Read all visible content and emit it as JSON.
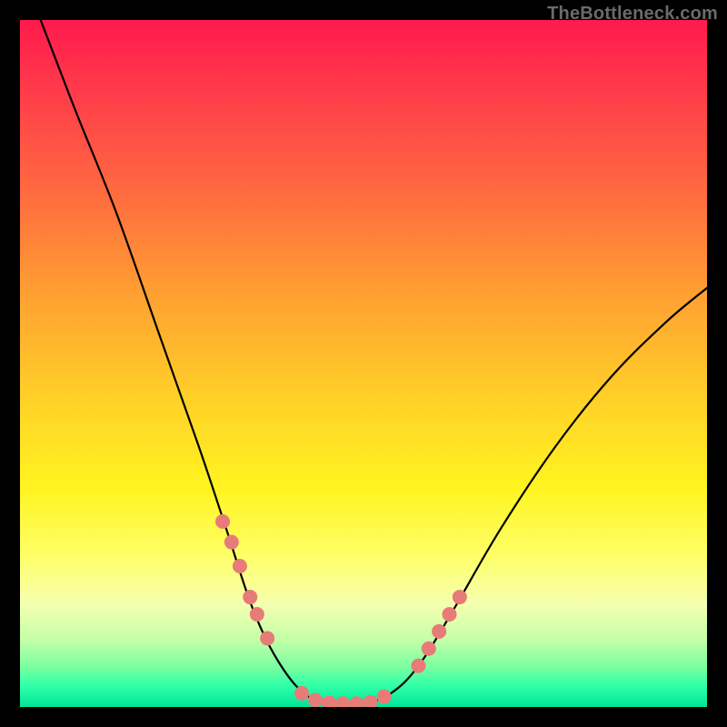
{
  "watermark": "TheBottleneck.com",
  "chart_data": {
    "type": "line",
    "title": "",
    "xlabel": "",
    "ylabel": "",
    "xlim": [
      0,
      100
    ],
    "ylim": [
      0,
      100
    ],
    "curve": {
      "name": "bottleneck-curve",
      "color": "#000000",
      "points": [
        {
          "x": 3.0,
          "y": 100.0
        },
        {
          "x": 8.0,
          "y": 87.0
        },
        {
          "x": 14.0,
          "y": 72.0
        },
        {
          "x": 20.0,
          "y": 55.0
        },
        {
          "x": 26.0,
          "y": 38.0
        },
        {
          "x": 30.0,
          "y": 26.0
        },
        {
          "x": 34.0,
          "y": 14.0
        },
        {
          "x": 38.0,
          "y": 6.0
        },
        {
          "x": 42.0,
          "y": 1.5
        },
        {
          "x": 46.0,
          "y": 0.5
        },
        {
          "x": 50.0,
          "y": 0.5
        },
        {
          "x": 54.0,
          "y": 2.0
        },
        {
          "x": 58.0,
          "y": 6.0
        },
        {
          "x": 63.0,
          "y": 14.0
        },
        {
          "x": 70.0,
          "y": 26.0
        },
        {
          "x": 78.0,
          "y": 38.0
        },
        {
          "x": 86.0,
          "y": 48.0
        },
        {
          "x": 94.0,
          "y": 56.0
        },
        {
          "x": 100.0,
          "y": 61.0
        }
      ]
    },
    "markers": {
      "name": "highlight-dots",
      "color": "#e77b78",
      "radius_px": 8,
      "points": [
        {
          "x": 29.5,
          "y": 27.0
        },
        {
          "x": 30.8,
          "y": 24.0
        },
        {
          "x": 32.0,
          "y": 20.5
        },
        {
          "x": 33.5,
          "y": 16.0
        },
        {
          "x": 34.5,
          "y": 13.5
        },
        {
          "x": 36.0,
          "y": 10.0
        },
        {
          "x": 41.0,
          "y": 2.0
        },
        {
          "x": 43.0,
          "y": 1.0
        },
        {
          "x": 45.0,
          "y": 0.6
        },
        {
          "x": 47.0,
          "y": 0.5
        },
        {
          "x": 49.0,
          "y": 0.5
        },
        {
          "x": 51.0,
          "y": 0.7
        },
        {
          "x": 53.0,
          "y": 1.5
        },
        {
          "x": 58.0,
          "y": 6.0
        },
        {
          "x": 59.5,
          "y": 8.5
        },
        {
          "x": 61.0,
          "y": 11.0
        },
        {
          "x": 62.5,
          "y": 13.5
        },
        {
          "x": 64.0,
          "y": 16.0
        }
      ]
    },
    "gradient_stops": [
      {
        "pos": 0.0,
        "color": "#ff1a4d"
      },
      {
        "pos": 0.25,
        "color": "#ff6a40"
      },
      {
        "pos": 0.55,
        "color": "#ffd028"
      },
      {
        "pos": 0.78,
        "color": "#feff68"
      },
      {
        "pos": 0.92,
        "color": "#9effa4"
      },
      {
        "pos": 1.0,
        "color": "#00e59a"
      }
    ]
  }
}
